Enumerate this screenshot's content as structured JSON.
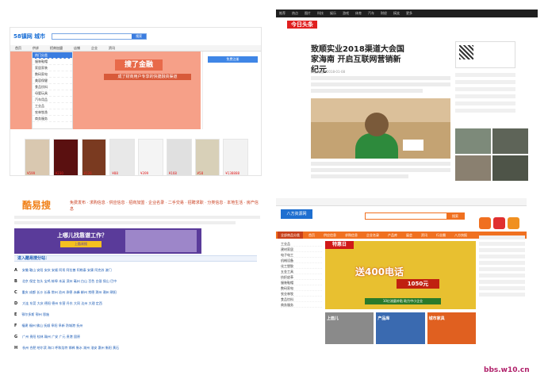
{
  "q1": {
    "logo": "58镇网 城市",
    "search_btn": "搜索",
    "nav": [
      "首页",
      "供求",
      "招商加盟",
      "店铺",
      "企业",
      "资讯"
    ],
    "side_items": [
      "热门分类",
      "服装鞋帽",
      "家居家装",
      "数码家电",
      "美容保健",
      "食品饮料",
      "母婴玩具",
      "汽车用品",
      "工业品",
      "农林牧渔",
      "商务服务"
    ],
    "banner_title": "搜了金融",
    "banner_sub": "成了财商用户专享的快捷融资渠道",
    "login": "免费注册",
    "products": [
      "¥599",
      "¥230",
      "¥128",
      "¥88",
      "¥399",
      "¥168",
      "¥58",
      "¥138888"
    ]
  },
  "q2": {
    "logo": "今日头条",
    "topbar": [
      "推荐",
      "热点",
      "图片",
      "科技",
      "娱乐",
      "游戏",
      "体育",
      "汽车",
      "财经",
      "搞笑",
      "更多"
    ],
    "title": "致顺实业2018渠道大会国家海南 开启互联网营销新纪元",
    "meta": "实业频道 · 2018-01-08"
  },
  "q3": {
    "logo": "酷易搜",
    "top_links": "免费发布 · 求购信息 · 供应信息 · 招商加盟 · 企业名录 · 二手交易 · 招聘求职 · 分类信息 · 本地生活 · 房产信息",
    "banner_t1": "上哪儿找靠谱工作？",
    "banner_t2": "上酷易搜",
    "bar_title": "进入酷易搜分站：",
    "rows": [
      {
        "k": "A",
        "v": "安徽 鞍山 安阳 安庆 安顺 阿坝 阿拉善 阿勒泰 安康 阿克苏 澳门"
      },
      {
        "k": "B",
        "v": "北京 保定 包头 宝鸡 蚌埠 本溪 滨州 亳州 白山 百色 白银 保山 巴中"
      },
      {
        "k": "C",
        "v": "重庆 成都 长沙 长春 常州 沧州 承德 赤峰 郴州 常德 滁州 潮州 朝阳"
      },
      {
        "k": "D",
        "v": "大连 东莞 大庆 德阳 德州 东营 丹东 大同 达州 大理 定西"
      },
      {
        "k": "E",
        "v": "鄂尔多斯 鄂州 恩施"
      },
      {
        "k": "F",
        "v": "福建 福州 佛山 抚顺 阜阳 阜新 防城港 抚州"
      },
      {
        "k": "G",
        "v": "广州 贵阳 桂林 赣州 广安 广元 贵港 固原"
      },
      {
        "k": "H",
        "v": "杭州 合肥 哈尔滨 海口 呼和浩特 邯郸 衡水 湖州 淮安 惠州 衡阳 黄石"
      }
    ]
  },
  "q4": {
    "logo": "八方资源网",
    "search_btn": "搜索",
    "nav": [
      "全部商品分类",
      "首页",
      "供应信息",
      "求购信息",
      "企业名录",
      "产品库",
      "展会",
      "资讯",
      "行业圈",
      "八方快报"
    ],
    "side": [
      "工业品",
      "建材家居",
      "电子电工",
      "机械设备",
      "化工塑胶",
      "五金工具",
      "纺织皮革",
      "服装鞋帽",
      "数码家电",
      "农业林牧",
      "食品饮料",
      "商务服务"
    ],
    "ribbon": "特惠日",
    "big": "送400电话",
    "sub": "1050元",
    "bottom": "10亿流量补贴 助力中小企业",
    "tiles": [
      "上面儿",
      "产品库",
      "城市家具"
    ]
  },
  "watermark": "bbs.w10.cn"
}
